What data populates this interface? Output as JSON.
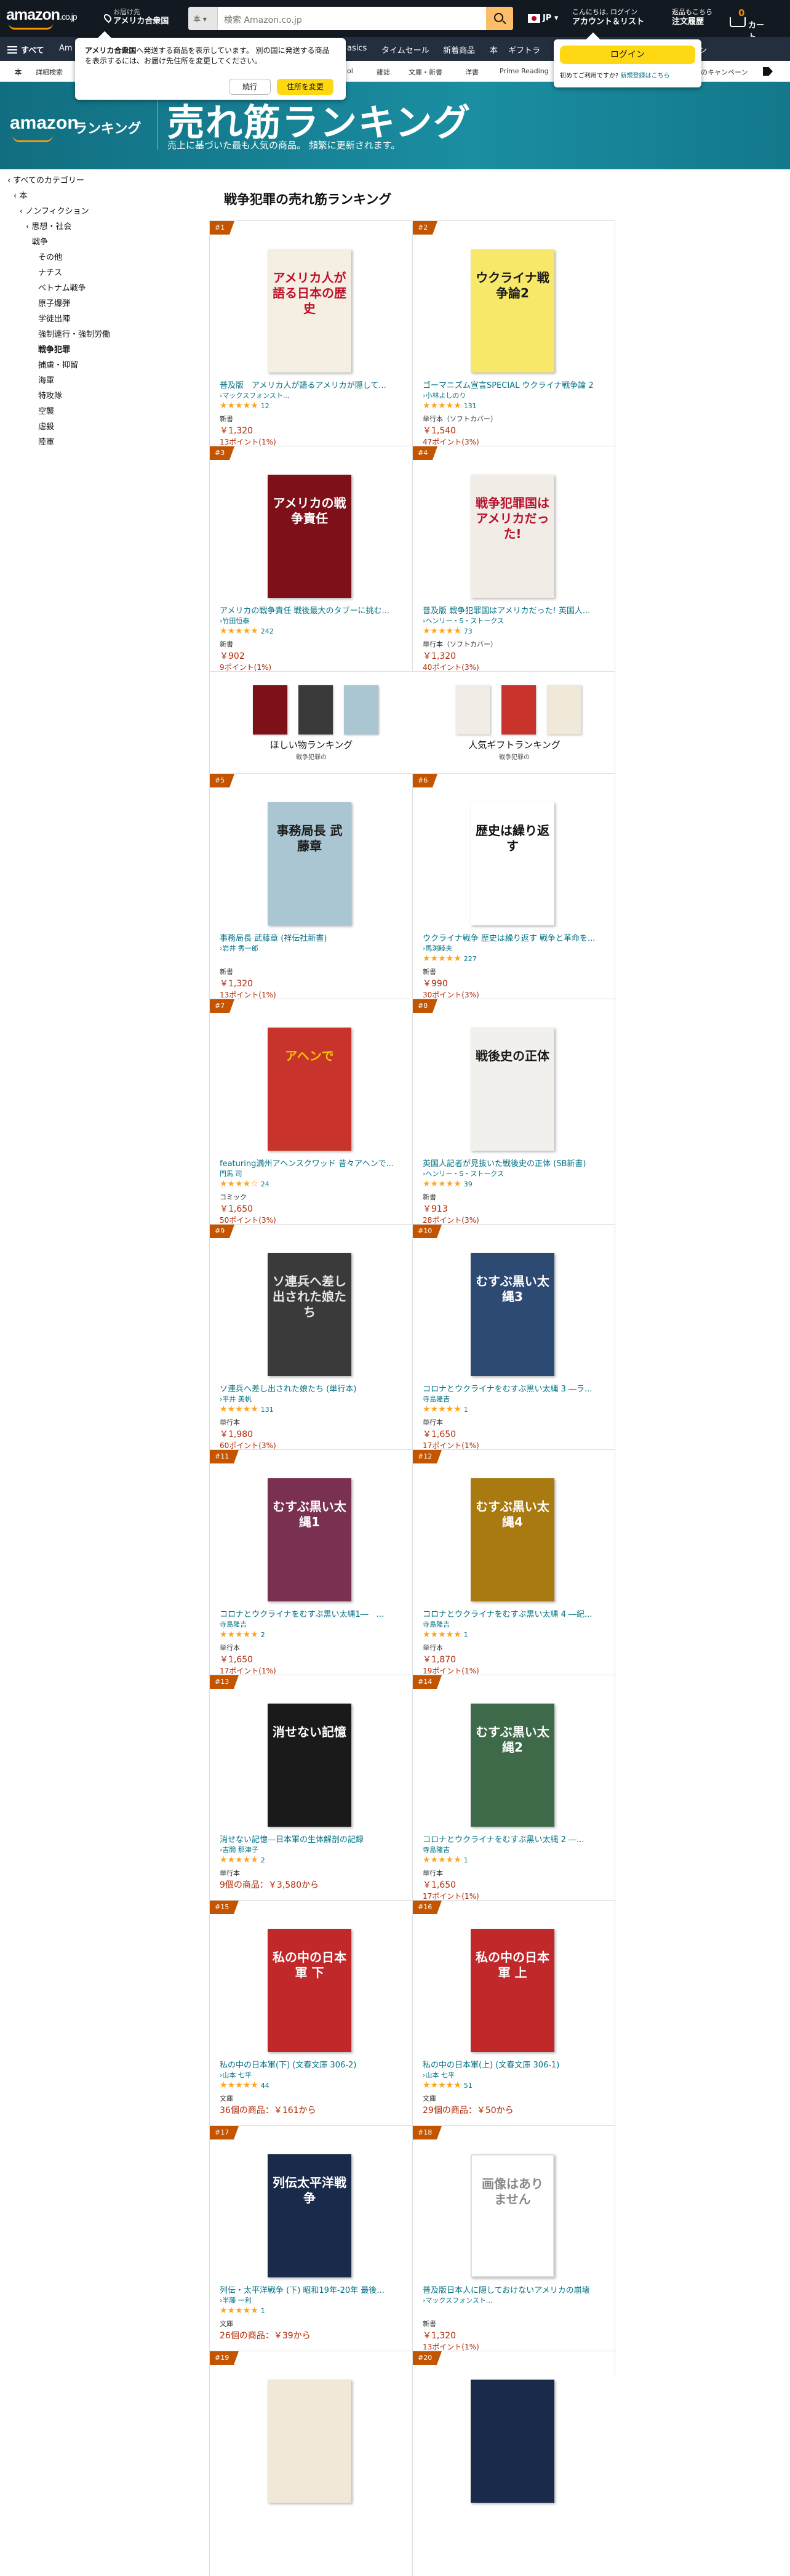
{
  "header": {
    "logo": "amazon",
    "logo_suffix": ".co.jp",
    "deliver_top": "お届け先",
    "deliver_bottom": "アメリカ合衆国",
    "search_category": "本",
    "search_placeholder": "検索 Amazon.co.jp",
    "lang": "JP",
    "acct_top": "こんにちは, ログイン",
    "acct_bottom": "アカウント＆リスト",
    "orders_top": "返品もこちら",
    "orders_bottom": "注文履歴",
    "cart_count": "0",
    "cart_label": "カート",
    "search_icon": "search-icon",
    "cart_icon": "cart-icon",
    "brand_color": "#ff9900"
  },
  "nav": {
    "all": "すべて",
    "items": [
      "Am",
      "asics",
      "タイムセール",
      "新着商品",
      "本",
      "ギフトラ",
      "ーゲン"
    ]
  },
  "subnav": {
    "items": [
      "本",
      "詳細検索",
      "ol",
      "雑誌",
      "文庫・新書",
      "洋書",
      "Prime Reading",
      "本のキャンペーン"
    ]
  },
  "banner": {
    "logo": "amazon",
    "logo_suffix": "ランキング",
    "title": "売れ筋ランキング",
    "subtitle": "売上に基づいた最も人気の商品。 頻繁に更新されます。"
  },
  "popup": {
    "text_bold": "アメリカ合衆国",
    "text": "へ発送する商品を表示しています。 別の国に発送する商品を表示するには、お届け先住所を変更してください。",
    "continue": "続行",
    "change": "住所を変更"
  },
  "signin": {
    "login": "ログイン",
    "new_customer": "初めてご利用ですか?",
    "new_link": "新規登録はこちら"
  },
  "sidebar": {
    "items": [
      {
        "label": "‹ すべてのカテゴリー",
        "indent": 0
      },
      {
        "label": "‹ 本",
        "indent": 1
      },
      {
        "label": "‹ ノンフィクション",
        "indent": 2
      },
      {
        "label": "‹ 思想・社会",
        "indent": 3
      },
      {
        "label": "戦争",
        "indent": 4
      },
      {
        "label": "その他",
        "indent": 5
      },
      {
        "label": "ナチス",
        "indent": 5
      },
      {
        "label": "ベトナム戦争",
        "indent": 5
      },
      {
        "label": "原子爆弾",
        "indent": 5
      },
      {
        "label": "学徒出陣",
        "indent": 5
      },
      {
        "label": "強制連行・強制労働",
        "indent": 5
      },
      {
        "label": "戦争犯罪",
        "indent": 5,
        "bold": true
      },
      {
        "label": "捕虜・抑留",
        "indent": 5
      },
      {
        "label": "海軍",
        "indent": 5
      },
      {
        "label": "特攻隊",
        "indent": 5
      },
      {
        "label": "空襲",
        "indent": 5
      },
      {
        "label": "虐殺",
        "indent": 5
      },
      {
        "label": "陸軍",
        "indent": 5
      }
    ]
  },
  "page_title": "戦争犯罪の売れ筋ランキング",
  "promo": {
    "wish": "ほしい物ランキング",
    "wish_sub": "戦争犯罪の",
    "gift": "人気ギフトランキング",
    "gift_sub": "戦争犯罪の"
  },
  "products": [
    {
      "rank": "#1",
      "title": "普及版　アメリカ人が語るアメリカが隠して...",
      "author": "›マックスフォンスト...",
      "stars": "★★★★★",
      "reviews": "12",
      "format": "新書",
      "price": "￥1,320",
      "points": "13ポイント(1%)",
      "cover_text": "アメリカ人が語る日本の歴史",
      "cover_bg": "#f4efe2",
      "cover_fg": "#c0102a"
    },
    {
      "rank": "#2",
      "title": "ゴーマニズム宣言SPECIAL ウクライナ戦争論 2",
      "author": "›小林よしのり",
      "stars": "★★★★★",
      "reviews": "131",
      "format": "単行本（ソフトカバー）",
      "price": "￥1,540",
      "points": "47ポイント(3%)",
      "cover_text": "ウクライナ戦争論2",
      "cover_bg": "#f7e86a",
      "cover_fg": "#1a1a1a"
    },
    {
      "rank": "#3",
      "title": "アメリカの戦争責任 戦後最大のタブーに挑む...",
      "author": "›竹田恒泰",
      "stars": "★★★★★",
      "reviews": "242",
      "format": "新書",
      "price": "￥902",
      "points": "9ポイント(1%)",
      "cover_text": "アメリカの戦争責任",
      "cover_bg": "#7d1018",
      "cover_fg": "#ffffff"
    },
    {
      "rank": "#4",
      "title": "普及版 戦争犯罪国はアメリカだった! 英国人...",
      "author": "›ヘンリー・S・ストークス",
      "stars": "★★★★★",
      "reviews": "73",
      "format": "単行本（ソフトカバー）",
      "price": "￥1,320",
      "points": "40ポイント(3%)",
      "cover_text": "戦争犯罪国はアメリカだった!",
      "cover_bg": "#f1ece6",
      "cover_fg": "#b8102a"
    },
    {
      "rank": "#5",
      "title": "事務局長 武藤章 (祥伝社新書)",
      "author": "›岩井 秀一郎",
      "stars": "",
      "reviews": "",
      "format": "新書",
      "price": "￥1,320",
      "points": "13ポイント(1%)",
      "cover_text": "事務局長 武藤章",
      "cover_bg": "#aac6d2",
      "cover_fg": "#1a1a1a"
    },
    {
      "rank": "#6",
      "title": "ウクライナ戦争 歴史は繰り返す 戦争と革命を...",
      "author": "›馬渕睦夫",
      "stars": "★★★★★",
      "reviews": "227",
      "format": "新書",
      "price": "￥990",
      "points": "30ポイント(3%)",
      "cover_text": "歴史は繰り返す",
      "cover_bg": "#ffffff",
      "cover_fg": "#111111"
    },
    {
      "rank": "#7",
      "title": "featuring満州アヘンスクワッド 昔々アヘンで...",
      "author": "門馬 司",
      "stars": "★★★★☆",
      "reviews": "24",
      "format": "コミック",
      "price": "￥1,650",
      "points": "50ポイント(3%)",
      "cover_text": "アヘンで",
      "cover_bg": "#c8342b",
      "cover_fg": "#f5c400"
    },
    {
      "rank": "#8",
      "title": "英国人記者が見抜いた戦後史の正体 (SB新書)",
      "author": "›ヘンリー・S・ストークス",
      "stars": "★★★★★",
      "reviews": "39",
      "format": "新書",
      "price": "￥913",
      "points": "28ポイント(3%)",
      "cover_text": "戦後史の正体",
      "cover_bg": "#f2f0ec",
      "cover_fg": "#1a1a1a"
    },
    {
      "rank": "#9",
      "title": "ソ連兵へ差し出された娘たち (単行本)",
      "author": "›平井 美帆",
      "stars": "★★★★★",
      "reviews": "131",
      "format": "単行本",
      "price": "￥1,980",
      "points": "60ポイント(3%)",
      "cover_text": "ソ連兵へ差し出された娘たち",
      "cover_bg": "#3a3a3a",
      "cover_fg": "#e8e8e8"
    },
    {
      "rank": "#10",
      "title": "コロナとウクライナをむすぶ黒い太縄 3 ―ラ...",
      "author": "寺島隆吉",
      "stars": "★★★★★",
      "reviews": "1",
      "format": "単行本",
      "price": "￥1,650",
      "points": "17ポイント(1%)",
      "cover_text": "むすぶ黒い太縄3",
      "cover_bg": "#2c4a72",
      "cover_fg": "#ffffff"
    },
    {
      "rank": "#11",
      "title": "コロナとウクライナをむすぶ黒い太縄1―　...",
      "author": "寺島隆吉",
      "stars": "★★★★★",
      "reviews": "2",
      "format": "単行本",
      "price": "￥1,650",
      "points": "17ポイント(1%)",
      "cover_text": "むすぶ黒い太縄1",
      "cover_bg": "#7a3050",
      "cover_fg": "#ffffff"
    },
    {
      "rank": "#12",
      "title": "コロナとウクライナをむすぶ黒い太縄 4 ―紀...",
      "author": "寺島隆吉",
      "stars": "★★★★★",
      "reviews": "1",
      "format": "単行本",
      "price": "￥1,870",
      "points": "19ポイント(1%)",
      "cover_text": "むすぶ黒い太縄4",
      "cover_bg": "#a87a10",
      "cover_fg": "#ffffff"
    },
    {
      "rank": "#13",
      "title": "消せない記憶―日本軍の生体解剖の記録",
      "author": "›吉開 那津子",
      "stars": "★★★★★",
      "reviews": "2",
      "format": "単行本",
      "price": "9個の商品：￥3,580から",
      "points": "",
      "cover_text": "消せない記憶",
      "cover_bg": "#1a1a1a",
      "cover_fg": "#ffffff"
    },
    {
      "rank": "#14",
      "title": "コロナとウクライナをむすぶ黒い太縄 2 ―...",
      "author": "寺島隆吉",
      "stars": "★★★★★",
      "reviews": "1",
      "format": "単行本",
      "price": "￥1,650",
      "points": "17ポイント(1%)",
      "cover_text": "むすぶ黒い太縄2",
      "cover_bg": "#3e6a4a",
      "cover_fg": "#ffffff"
    },
    {
      "rank": "#15",
      "title": "私の中の日本軍(下) (文春文庫 306-2)",
      "author": "›山本 七平",
      "stars": "★★★★★",
      "reviews": "44",
      "format": "文庫",
      "price": "36個の商品：￥161から",
      "points": "",
      "cover_text": "私の中の日本軍 下",
      "cover_bg": "#c0282a",
      "cover_fg": "#ffffff"
    },
    {
      "rank": "#16",
      "title": "私の中の日本軍(上) (文春文庫 306-1)",
      "author": "›山本 七平",
      "stars": "★★★★★",
      "reviews": "51",
      "format": "文庫",
      "price": "29個の商品：￥50から",
      "points": "",
      "cover_text": "私の中の日本軍 上",
      "cover_bg": "#c0282a",
      "cover_fg": "#ffffff"
    },
    {
      "rank": "#17",
      "title": "列伝・太平洋戦争 (下) 昭和19年-20年 最後...",
      "author": "›半藤 一利",
      "stars": "★★★★★",
      "reviews": "1",
      "format": "文庫",
      "price": "26個の商品：￥39から",
      "points": "",
      "cover_text": "列伝太平洋戦争",
      "cover_bg": "#1a2a4a",
      "cover_fg": "#ffffff"
    },
    {
      "rank": "#18",
      "title": "普及版日本人に隠しておけないアメリカの崩壊",
      "author": "›マックスフォンスト...",
      "stars": "",
      "reviews": "",
      "format": "新書",
      "price": "￥1,320",
      "points": "13ポイント(1%)",
      "cover_text": "画像はありません",
      "cover_bg": "#ffffff",
      "cover_fg": "#999999"
    },
    {
      "rank": "#19",
      "title": "",
      "author": "",
      "stars": "",
      "reviews": "",
      "format": "",
      "price": "",
      "points": "",
      "cover_text": "",
      "cover_bg": "#f0e8d8",
      "cover_fg": "#8a1a1a"
    },
    {
      "rank": "#20",
      "title": "",
      "author": "",
      "stars": "",
      "reviews": "",
      "format": "",
      "price": "",
      "points": "",
      "cover_text": "",
      "cover_bg": "#1a2a4a",
      "cover_fg": "#ffffff"
    }
  ]
}
